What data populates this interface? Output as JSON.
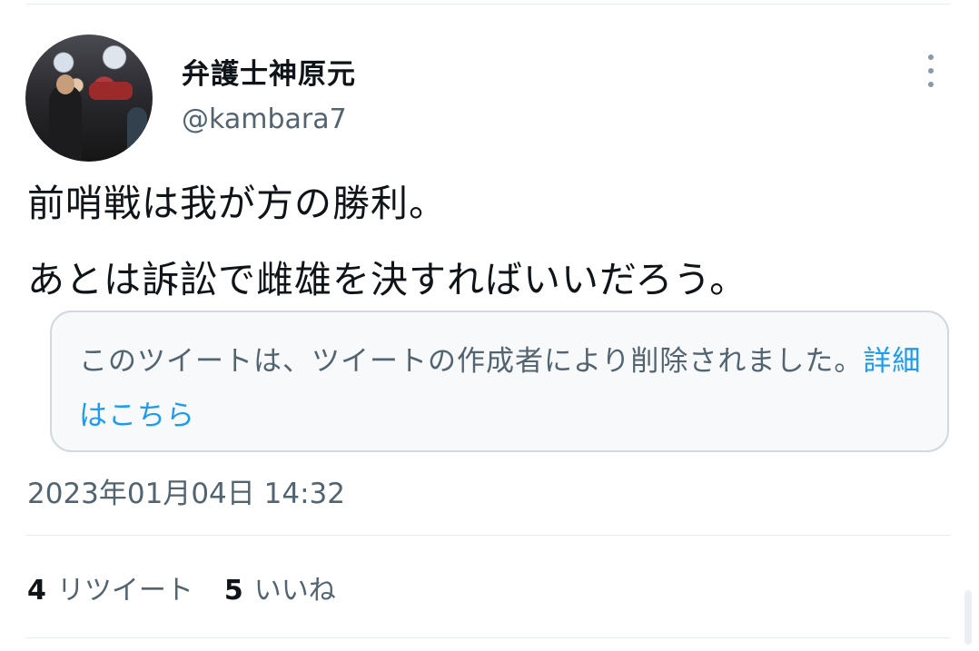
{
  "author": {
    "display_name": "弁護士神原元",
    "handle": "@kambara7"
  },
  "tweet": {
    "lines": [
      "前哨戦は我が方の勝利。",
      "あとは訴訟で雌雄を決すればいいだろう。"
    ]
  },
  "quote": {
    "text": "このツイートは、ツイートの作成者により削除されました。",
    "link_label": "詳細はこちら"
  },
  "timestamp": "2023年01月04日 14:32",
  "stats": {
    "retweets_count": "4",
    "retweets_label": "リツイート",
    "likes_count": "5",
    "likes_label": "いいね"
  },
  "icons": {
    "more": "more-vertical-icon"
  },
  "colors": {
    "text_primary": "#0f1419",
    "text_secondary": "#536471",
    "link": "#1d9bf0",
    "card_border": "#cfd9de",
    "card_bg": "#f7f9fa"
  }
}
